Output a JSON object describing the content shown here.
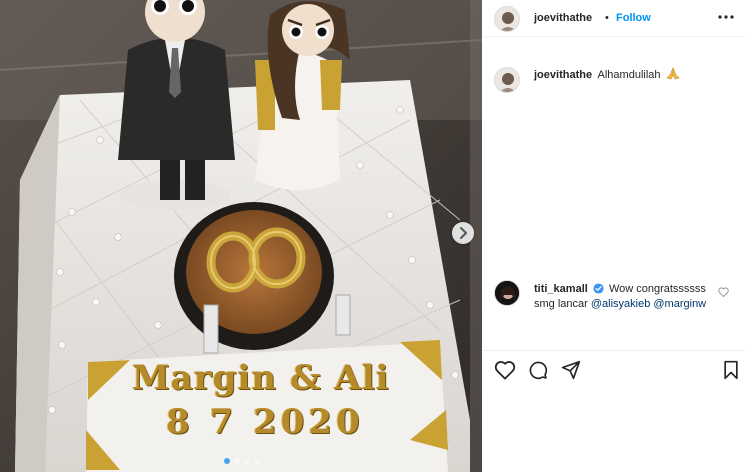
{
  "post": {
    "username": "joevithathe",
    "separator": "•",
    "follow_label": "Follow",
    "carousel": {
      "total_slides": 4,
      "active_slide": 1
    },
    "photo_text": {
      "names": "Margin & Ali",
      "date": "8 7 2020"
    }
  },
  "caption": {
    "username": "joevithathe",
    "text": "Alhamdulilah"
  },
  "comments": [
    {
      "username": "titi_kamall",
      "verified": true,
      "text": "Wow congratssssss smg lancar",
      "mentions": [
        "@alisyakieb",
        "@marginw"
      ]
    }
  ],
  "icons": {
    "more": "more-options-icon",
    "next": "carousel-next-icon",
    "like": "heart-icon",
    "comment": "comment-icon",
    "share": "share-icon",
    "save": "bookmark-icon",
    "verified": "verified-badge-icon",
    "pray": "pray-emoji-icon"
  },
  "colors": {
    "follow": "#0095f6",
    "mention": "#00376b",
    "verified": "#3897f0",
    "text": "#262626"
  }
}
